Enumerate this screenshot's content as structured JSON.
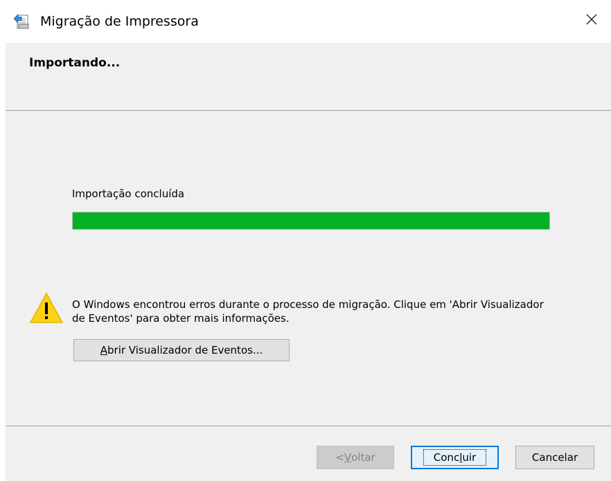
{
  "window": {
    "title": "Migração de Impressora",
    "app_icon": "printer-migration-icon",
    "close_icon": "close-icon"
  },
  "header": {
    "title": "Importando..."
  },
  "progress": {
    "label": "Importação concluída",
    "percent": 100,
    "fill_color": "#06b025"
  },
  "warning": {
    "icon": "warning-icon",
    "message": "O Windows encontrou erros durante o processo de migração. Clique em 'Abrir Visualizador de Eventos' para obter mais informações.",
    "button_access_key": "A",
    "button_label_rest": "brir Visualizador de Eventos..."
  },
  "footer": {
    "back_prefix": "< ",
    "back_access_key": "V",
    "back_rest": "oltar",
    "back_enabled": false,
    "finish_prefix": "Conc",
    "finish_access_key": "l",
    "finish_rest": "uir",
    "cancel_label": "Cancelar"
  },
  "colors": {
    "accent": "#0078d7",
    "panel": "#f0f0f0",
    "warning_yellow": "#fcd116"
  }
}
